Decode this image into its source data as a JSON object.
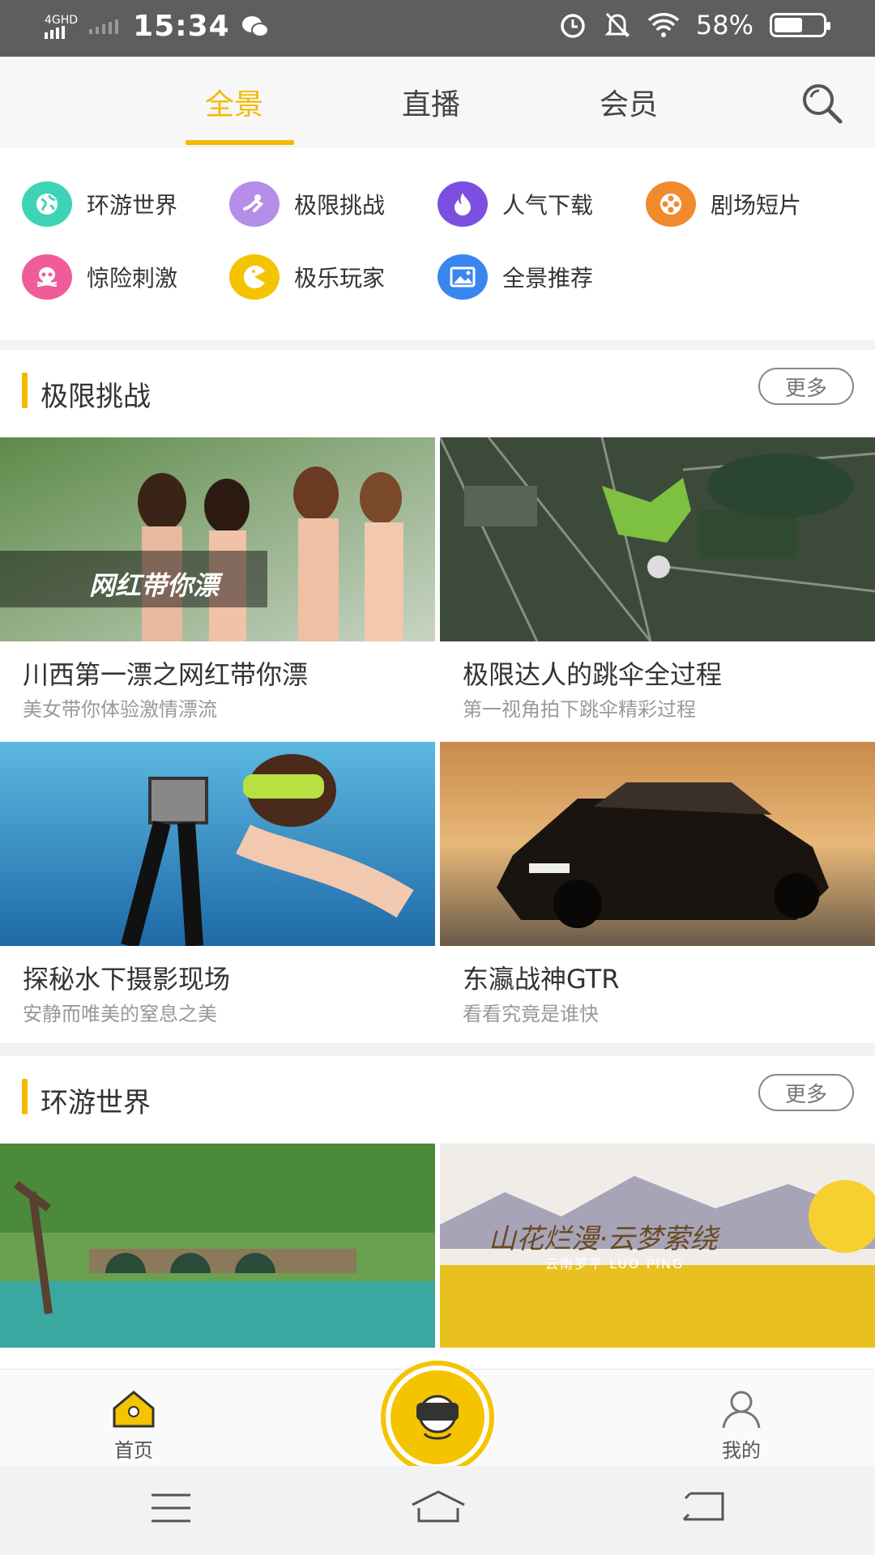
{
  "status_bar": {
    "network": "4GHD",
    "time": "15:34",
    "battery": "58%",
    "battery_level": 0.58
  },
  "top_tabs": [
    {
      "label": "全景",
      "active": true
    },
    {
      "label": "直播",
      "active": false
    },
    {
      "label": "会员",
      "active": false
    }
  ],
  "categories": [
    {
      "label": "环游世界",
      "icon": "globe-icon",
      "color": "#3ed3b6"
    },
    {
      "label": "极限挑战",
      "icon": "dive-icon",
      "color": "#b58ee8"
    },
    {
      "label": "人气下载",
      "icon": "flame-icon",
      "color": "#7b4fe0"
    },
    {
      "label": "剧场短片",
      "icon": "film-reel-icon",
      "color": "#f08a2c"
    },
    {
      "label": "惊险刺激",
      "icon": "skull-icon",
      "color": "#f05b9a"
    },
    {
      "label": "极乐玩家",
      "icon": "pacman-icon",
      "color": "#f5c400"
    },
    {
      "label": "全景推荐",
      "icon": "picture-icon",
      "color": "#3a86f0"
    }
  ],
  "sections": [
    {
      "title": "极限挑战",
      "more": "更多",
      "cards": [
        {
          "title": "川西第一漂之网红带你漂",
          "subtitle": "美女带你体验激情漂流",
          "overlay": "网红带你漂"
        },
        {
          "title": "极限达人的跳伞全过程",
          "subtitle": "第一视角拍下跳伞精彩过程"
        },
        {
          "title": "探秘水下摄影现场",
          "subtitle": "安静而唯美的窒息之美"
        },
        {
          "title": "东瀛战神GTR",
          "subtitle": "看看究竟是谁快"
        }
      ]
    },
    {
      "title": "环游世界",
      "more": "更多",
      "cards": [
        {
          "image": "stone-bridge"
        },
        {
          "overlay": "山花烂漫·云梦萦绕",
          "overlay_sub": "云南罗平  LUO PING"
        }
      ]
    }
  ],
  "bottom_nav": [
    {
      "label": "首页",
      "icon": "home-icon",
      "active": true
    },
    {
      "label": "",
      "icon": "vr-headset-icon"
    },
    {
      "label": "我的",
      "icon": "user-icon",
      "active": false
    }
  ]
}
